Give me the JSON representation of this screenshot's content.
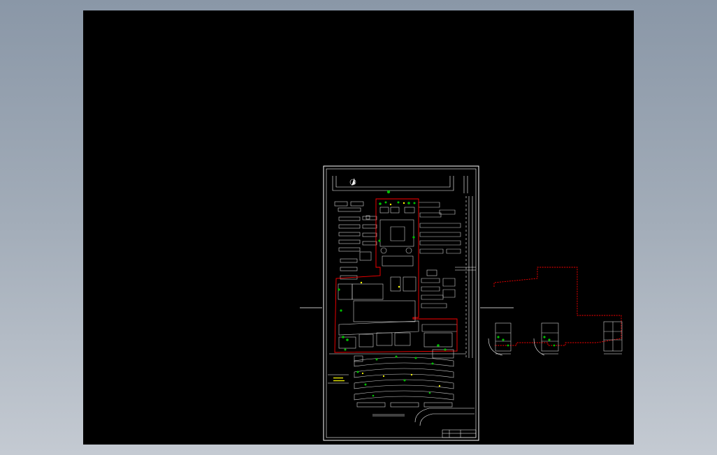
{
  "app": {
    "canvas": {
      "background_color": "#000000",
      "workspace_color": "#8f9cab"
    },
    "drawing": {
      "line_color": "#ffffff",
      "boundary_color": "#ff0000",
      "vegetation_color": "#00c000",
      "annotation_color": "#ffff00"
    }
  }
}
